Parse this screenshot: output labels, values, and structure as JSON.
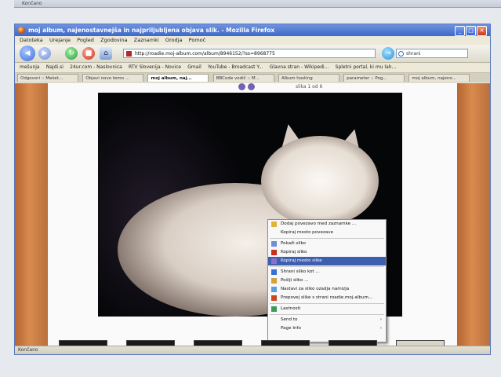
{
  "prev_status": "Končano",
  "window": {
    "title": "moj album, najenostavnejša in najpriljubljena objava slik. - Mozilla Firefox"
  },
  "menu": [
    "Datoteka",
    "Urejanje",
    "Pogled",
    "Zgodovina",
    "Zaznamki",
    "Orodja",
    "Pomoč"
  ],
  "address": "http://roadie.moj-album.com/album/8946152/?ss=8968775",
  "search_placeholder": "shrani",
  "bookmarks": [
    "mešunja",
    "Najdi.si",
    "24ur.com - Naslovnica",
    "RTV Slovenija - Novice",
    "Gmail",
    "YouTube - Broadcast Y...",
    "Glavna stran - Wikipedi...",
    "Spletni portal, ki mu lah..."
  ],
  "tabs": [
    {
      "label": "Odgovori :: Mešet...",
      "active": false
    },
    {
      "label": "Objavi novo temo ...",
      "active": false
    },
    {
      "label": "moj album, naj...",
      "active": true
    },
    {
      "label": "BBCode vodič :: M...",
      "active": false
    },
    {
      "label": "Album hosting",
      "active": false
    },
    {
      "label": "parameter :: Pog...",
      "active": false
    },
    {
      "label": "moj album, najeno...",
      "active": false
    }
  ],
  "photo_counter": "slika 1 od 6",
  "context_menu": [
    {
      "label": "Dodaj povezavo med zaznamke ...",
      "icon": "bookmark-icon"
    },
    {
      "label": "Kopiraj mesto povezave",
      "icon": ""
    },
    {
      "sep": true
    },
    {
      "label": "Pokaži sliko",
      "icon": "picture-icon"
    },
    {
      "label": "Kopiraj sliko",
      "icon": "copy-icon"
    },
    {
      "label": "Kopiraj mesto slike",
      "icon": "link-icon",
      "highlight": true
    },
    {
      "sep": true
    },
    {
      "label": "Shrani sliko kot ...",
      "icon": "save-icon"
    },
    {
      "label": "Pošlji sliko ...",
      "icon": "mail-icon"
    },
    {
      "label": "Nastavi za sliko ozadja namizja",
      "icon": "desktop-icon"
    },
    {
      "label": "Prepovej slike s strani roadie.moj-album...",
      "icon": "block-icon"
    },
    {
      "sep": true
    },
    {
      "label": "Lastnosti",
      "icon": "info-icon"
    },
    {
      "sep": true
    },
    {
      "label": "Send to",
      "icon": "",
      "submenu": true
    },
    {
      "label": "Page Info",
      "icon": "",
      "submenu": true
    }
  ],
  "statusbar": "Končano",
  "colors": {
    "titlebar": "#3c68c8",
    "menu_highlight": "#3d5fb0",
    "side_panel": "#c8773f"
  }
}
